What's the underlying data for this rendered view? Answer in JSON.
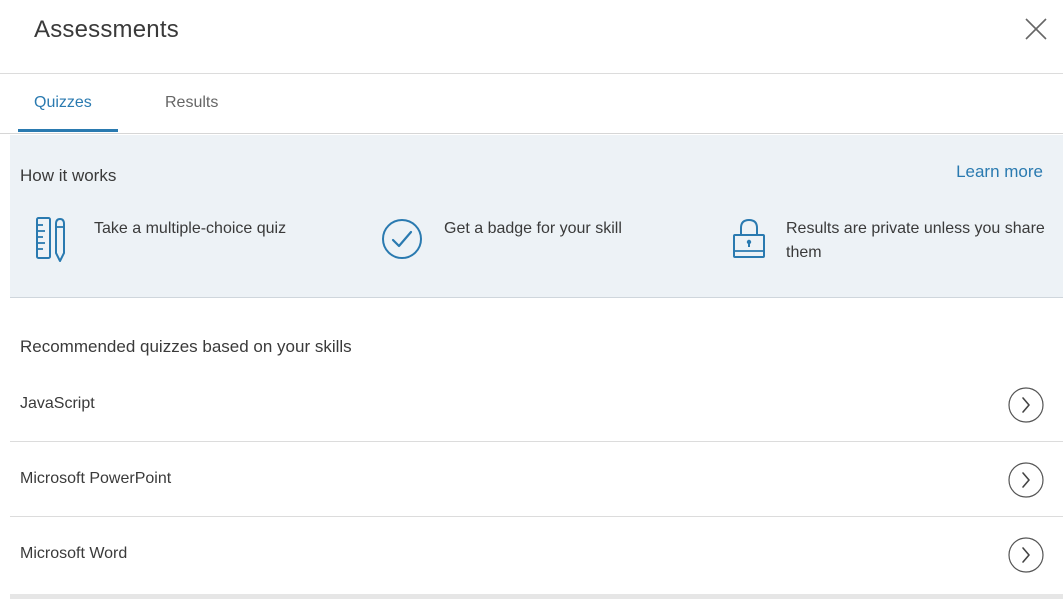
{
  "header": {
    "title": "Assessments",
    "close_icon": "close-icon"
  },
  "tabs": [
    {
      "label": "Quizzes",
      "active": true
    },
    {
      "label": "Results",
      "active": false
    }
  ],
  "how_it_works": {
    "title": "How it works",
    "learn_more": "Learn more",
    "steps": [
      {
        "icon": "ruler-pencil-icon",
        "text": "Take a multiple-choice quiz"
      },
      {
        "icon": "check-circle-icon",
        "text": "Get a badge for your skill"
      },
      {
        "icon": "lock-icon",
        "text": "Results are private unless you share them"
      }
    ]
  },
  "recommended": {
    "title": "Recommended quizzes based on your skills",
    "items": [
      {
        "name": "JavaScript",
        "icon": "chevron-right-circle-icon"
      },
      {
        "name": "Microsoft PowerPoint",
        "icon": "chevron-right-circle-icon"
      },
      {
        "name": "Microsoft Word",
        "icon": "chevron-right-circle-icon"
      }
    ]
  },
  "colors": {
    "accent": "#2a7ab0",
    "panel_bg": "#edf2f6",
    "text": "#3a3a3a"
  }
}
